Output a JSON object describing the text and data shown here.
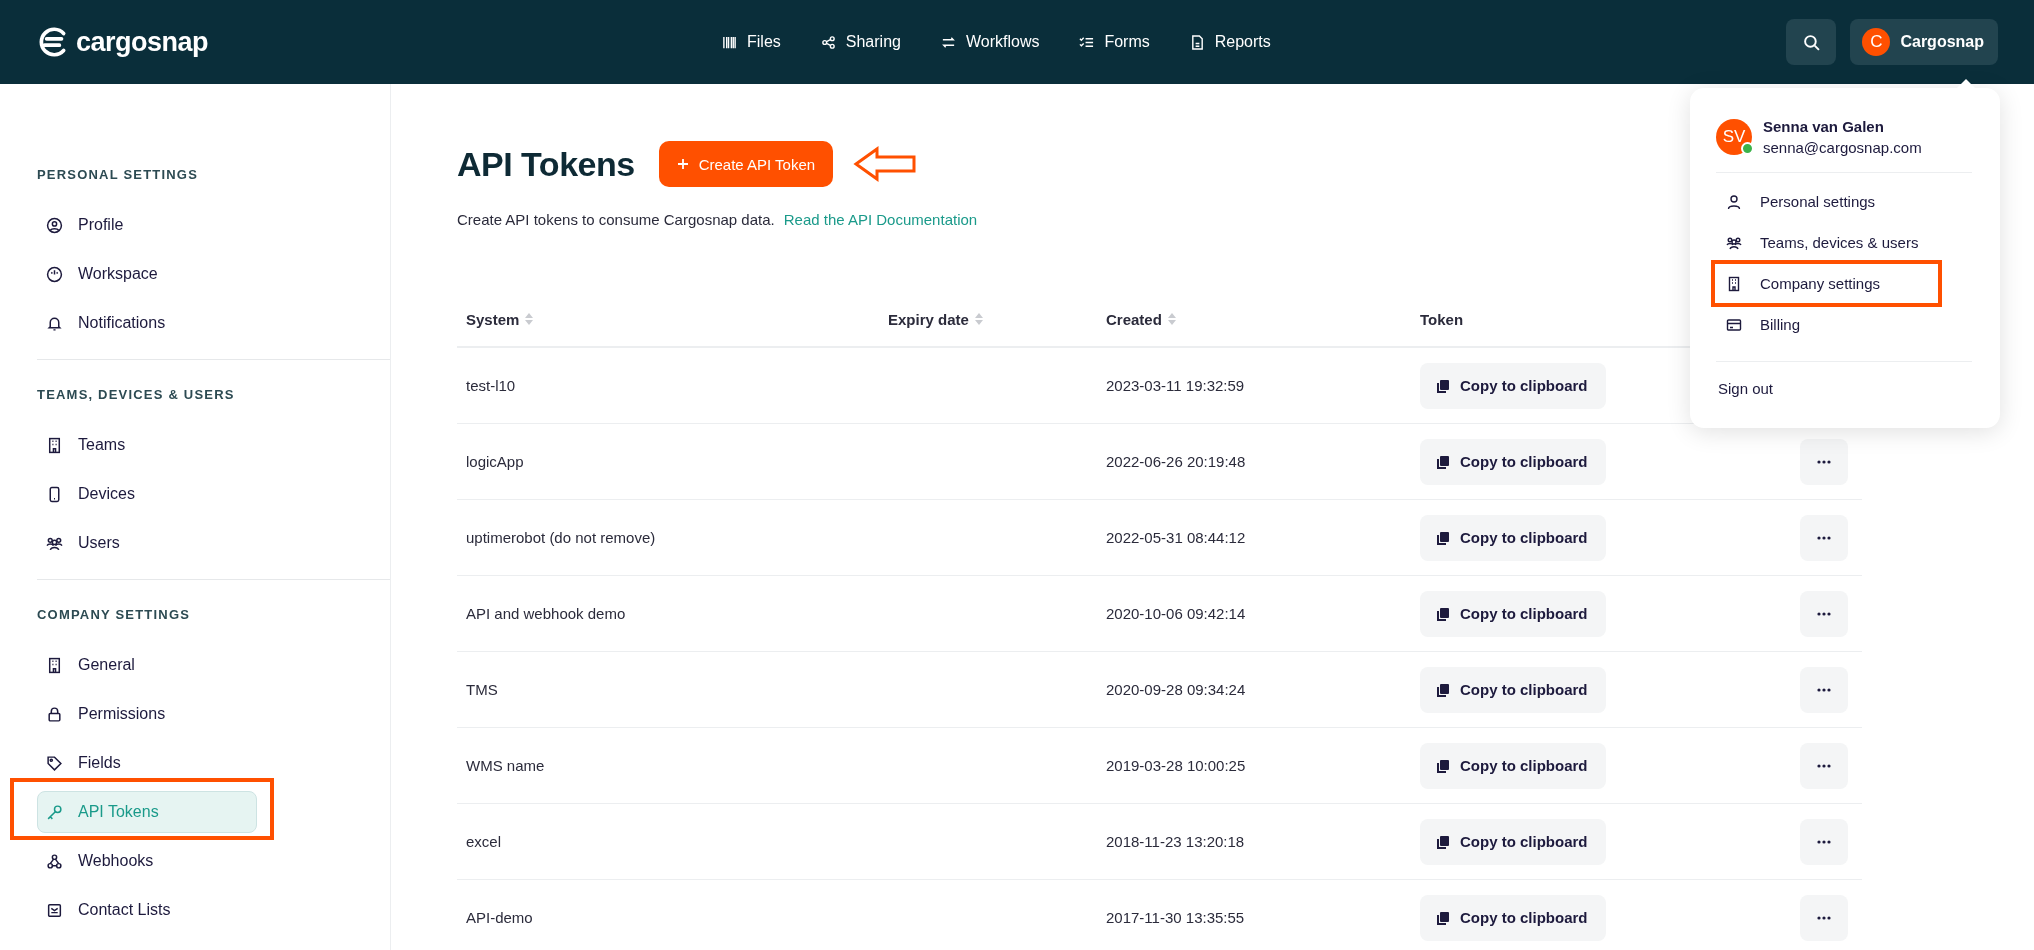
{
  "logo": {
    "text": "cargosnap"
  },
  "nav": [
    {
      "label": "Files"
    },
    {
      "label": "Sharing"
    },
    {
      "label": "Workflows"
    },
    {
      "label": "Forms"
    },
    {
      "label": "Reports"
    }
  ],
  "account": {
    "initial": "C",
    "name": "Cargosnap"
  },
  "sidebar": {
    "sections": [
      {
        "heading": "PERSONAL SETTINGS",
        "items": [
          {
            "label": "Profile",
            "selected": false,
            "annotated": false
          },
          {
            "label": "Workspace",
            "selected": false,
            "annotated": false
          },
          {
            "label": "Notifications",
            "selected": false,
            "annotated": false
          }
        ]
      },
      {
        "heading": "TEAMS, DEVICES & USERS",
        "items": [
          {
            "label": "Teams",
            "selected": false,
            "annotated": false
          },
          {
            "label": "Devices",
            "selected": false,
            "annotated": false
          },
          {
            "label": "Users",
            "selected": false,
            "annotated": false
          }
        ]
      },
      {
        "heading": "COMPANY SETTINGS",
        "items": [
          {
            "label": "General",
            "selected": false,
            "annotated": false
          },
          {
            "label": "Permissions",
            "selected": false,
            "annotated": false
          },
          {
            "label": "Fields",
            "selected": false,
            "annotated": false
          },
          {
            "label": "API Tokens",
            "selected": true,
            "annotated": true
          },
          {
            "label": "Webhooks",
            "selected": false,
            "annotated": false
          },
          {
            "label": "Contact Lists",
            "selected": false,
            "annotated": false
          }
        ]
      }
    ]
  },
  "page": {
    "title": "API Tokens",
    "create_button": {
      "label": "Create API Token",
      "annotated": true
    },
    "description": "Create API tokens to consume Cargosnap data.",
    "doc_link": "Read the API Documentation"
  },
  "table": {
    "columns": [
      {
        "label": "System",
        "sortable": true
      },
      {
        "label": "Expiry date",
        "sortable": true
      },
      {
        "label": "Created",
        "sortable": true
      },
      {
        "label": "Token",
        "sortable": false
      }
    ],
    "rows": [
      {
        "system": "test-l10",
        "created": "2023-03-11 19:32:59",
        "token_button": "Copy to clipboard",
        "actions_button": false
      },
      {
        "system": "logicApp",
        "created": "2022-06-26 20:19:48",
        "token_button": "Copy to clipboard",
        "actions_button": true
      },
      {
        "system": "uptimerobot (do not remove)",
        "created": "2022-05-31 08:44:12",
        "token_button": "Copy to clipboard",
        "actions_button": true
      },
      {
        "system": "API and webhook demo",
        "created": "2020-10-06 09:42:14",
        "token_button": "Copy to clipboard",
        "actions_button": true
      },
      {
        "system": "TMS",
        "created": "2020-09-28 09:34:24",
        "token_button": "Copy to clipboard",
        "actions_button": true
      },
      {
        "system": "WMS name",
        "created": "2019-03-28 10:00:25",
        "token_button": "Copy to clipboard",
        "actions_button": true
      },
      {
        "system": "excel",
        "created": "2018-11-23 13:20:18",
        "token_button": "Copy to clipboard",
        "actions_button": true
      },
      {
        "system": "API-demo",
        "created": "2017-11-30 13:35:55",
        "token_button": "Copy to clipboard",
        "actions_button": true
      }
    ]
  },
  "user_menu": {
    "initials": "SV",
    "online": true,
    "name": "Senna van Galen",
    "email": "senna@cargosnap.com",
    "items": [
      {
        "label": "Personal settings",
        "annotated": false
      },
      {
        "label": "Teams, devices & users",
        "annotated": false
      },
      {
        "label": "Company settings",
        "annotated": true
      },
      {
        "label": "Billing",
        "annotated": false
      }
    ],
    "sign_out": "Sign out"
  }
}
